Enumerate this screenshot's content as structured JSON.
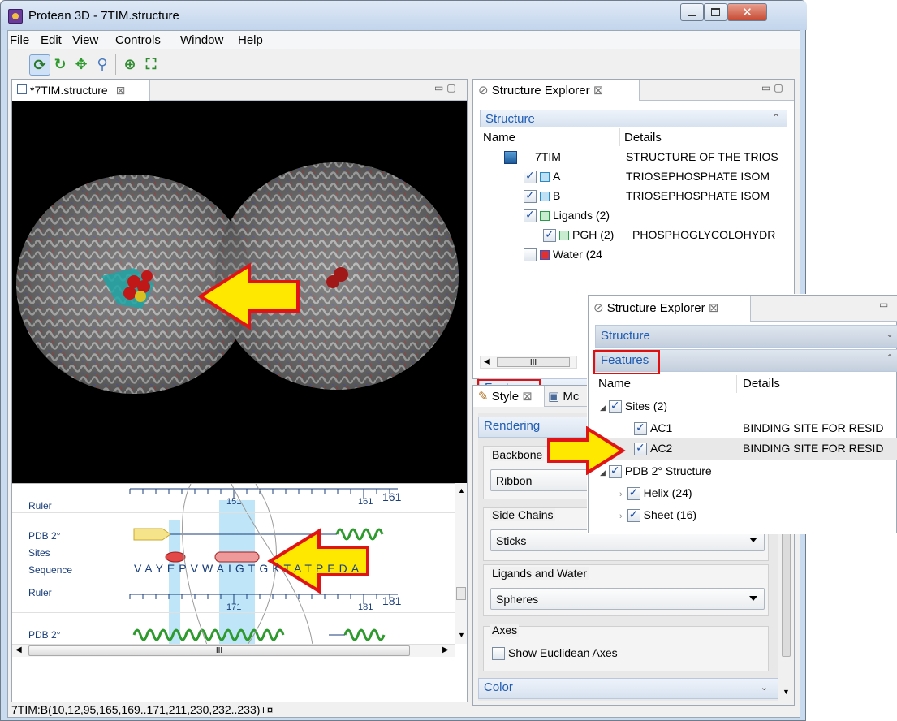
{
  "window": {
    "title": "Protean 3D - 7TIM.structure"
  },
  "menu": [
    "File",
    "Edit",
    "View",
    "Controls",
    "Window",
    "Help"
  ],
  "toolbar": {
    "icons": [
      "rotate-icon",
      "refresh-icon",
      "move-icon",
      "zoom-icon",
      "fit-icon",
      "fullscreen-icon"
    ]
  },
  "editor": {
    "tab": "*7TIM.structure",
    "sequence": {
      "ruler1": {
        "label": "Ruler",
        "ticks": [
          "151",
          "161"
        ],
        "end": "161"
      },
      "pdb2_label": "PDB 2°",
      "sites_label": "Sites",
      "sequence_label": "Sequence",
      "sequence_text": "VAYEPVWAIGTGKTATPEDA",
      "ruler2": {
        "label": "Ruler",
        "ticks": [
          "171",
          "181"
        ],
        "end": "181"
      },
      "pdb2_label_2": "PDB 2°"
    },
    "scroll_mark": "III"
  },
  "status": "7TIM:B(10,12,95,165,169..171,211,230,232..233)+¤",
  "explorer": {
    "tab": "Structure Explorer",
    "section": "Structure",
    "columns": [
      "Name",
      "Details"
    ],
    "rows": [
      {
        "name": "7TIM",
        "details": "STRUCTURE OF THE TRIOS"
      },
      {
        "name": "A",
        "details": "TRIOSEPHOSPHATE ISOM"
      },
      {
        "name": "B",
        "details": "TRIOSEPHOSPHATE ISOM"
      },
      {
        "name": "Ligands (2)",
        "details": ""
      },
      {
        "name": "PGH (2)",
        "details": "PHOSPHOGLYCOLOHYDR"
      },
      {
        "name": "Water (24",
        "details": ""
      }
    ],
    "scroll_mark": "III",
    "features": "Features"
  },
  "style": {
    "tabs": [
      "Style",
      "Mc"
    ],
    "rendering": "Rendering",
    "backbone_label": "Backbone",
    "backbone_value": "Ribbon",
    "sidechains_label": "Side Chains",
    "sidechains_value": "Sticks",
    "ligands_label": "Ligands and Water",
    "ligands_value": "Spheres",
    "axes_label": "Axes",
    "axes_checkbox": "Show Euclidean Axes",
    "color": "Color"
  },
  "zoom": {
    "tab": "Structure Explorer",
    "structure": "Structure",
    "features": "Features",
    "columns": [
      "Name",
      "Details"
    ],
    "rows": [
      {
        "name": "Sites (2)",
        "details": ""
      },
      {
        "name": "AC1",
        "details": "BINDING SITE FOR RESID"
      },
      {
        "name": "AC2",
        "details": "BINDING SITE FOR RESID"
      },
      {
        "name": "PDB 2° Structure",
        "details": ""
      },
      {
        "name": "Helix (24)",
        "details": ""
      },
      {
        "name": "Sheet (16)",
        "details": ""
      }
    ]
  }
}
